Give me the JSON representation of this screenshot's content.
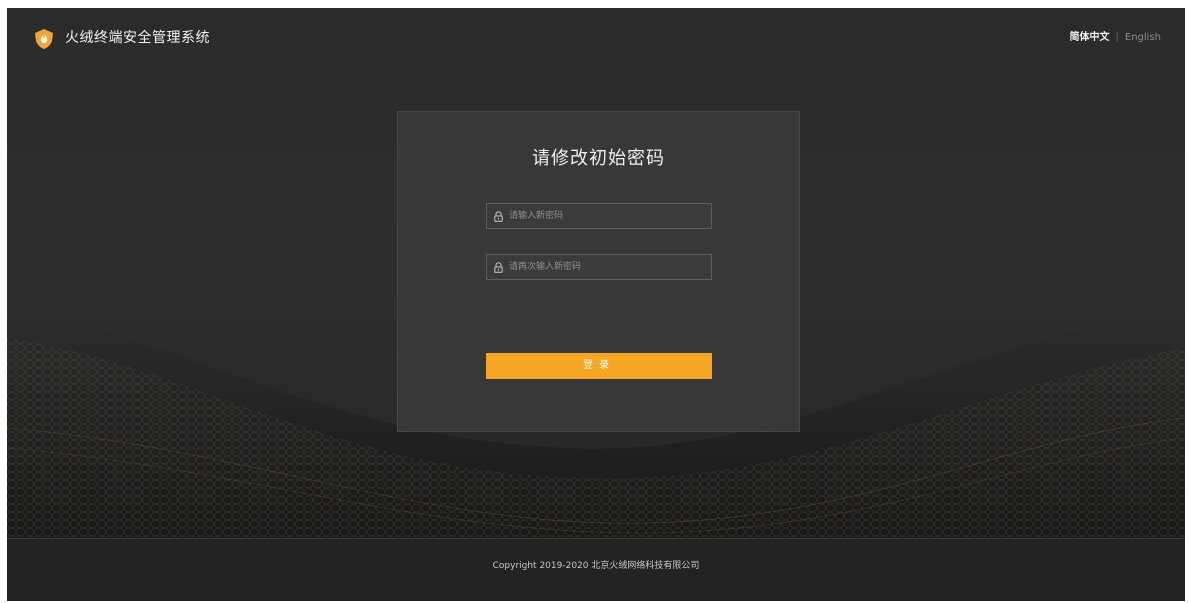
{
  "app": {
    "title": "火绒终端安全管理系统",
    "logo_icon": "flame-shield-icon"
  },
  "language": {
    "zh_label": "简体中文",
    "separator": "|",
    "en_label": "English",
    "active": "简体中文"
  },
  "form": {
    "title": "请修改初始密码",
    "new_password_placeholder": "请输入新密码",
    "confirm_password_placeholder": "请再次输入新密码",
    "new_password_value": "",
    "confirm_password_value": "",
    "field_icon": "lock-icon",
    "submit_label": "登录"
  },
  "footer": {
    "copyright": "Copyright 2019-2020 北京火绒网络科技有限公司"
  },
  "colors": {
    "accent": "#f5a623",
    "background": "#2b2b2b",
    "card": "#3a3a3a",
    "footer": "#232323"
  }
}
